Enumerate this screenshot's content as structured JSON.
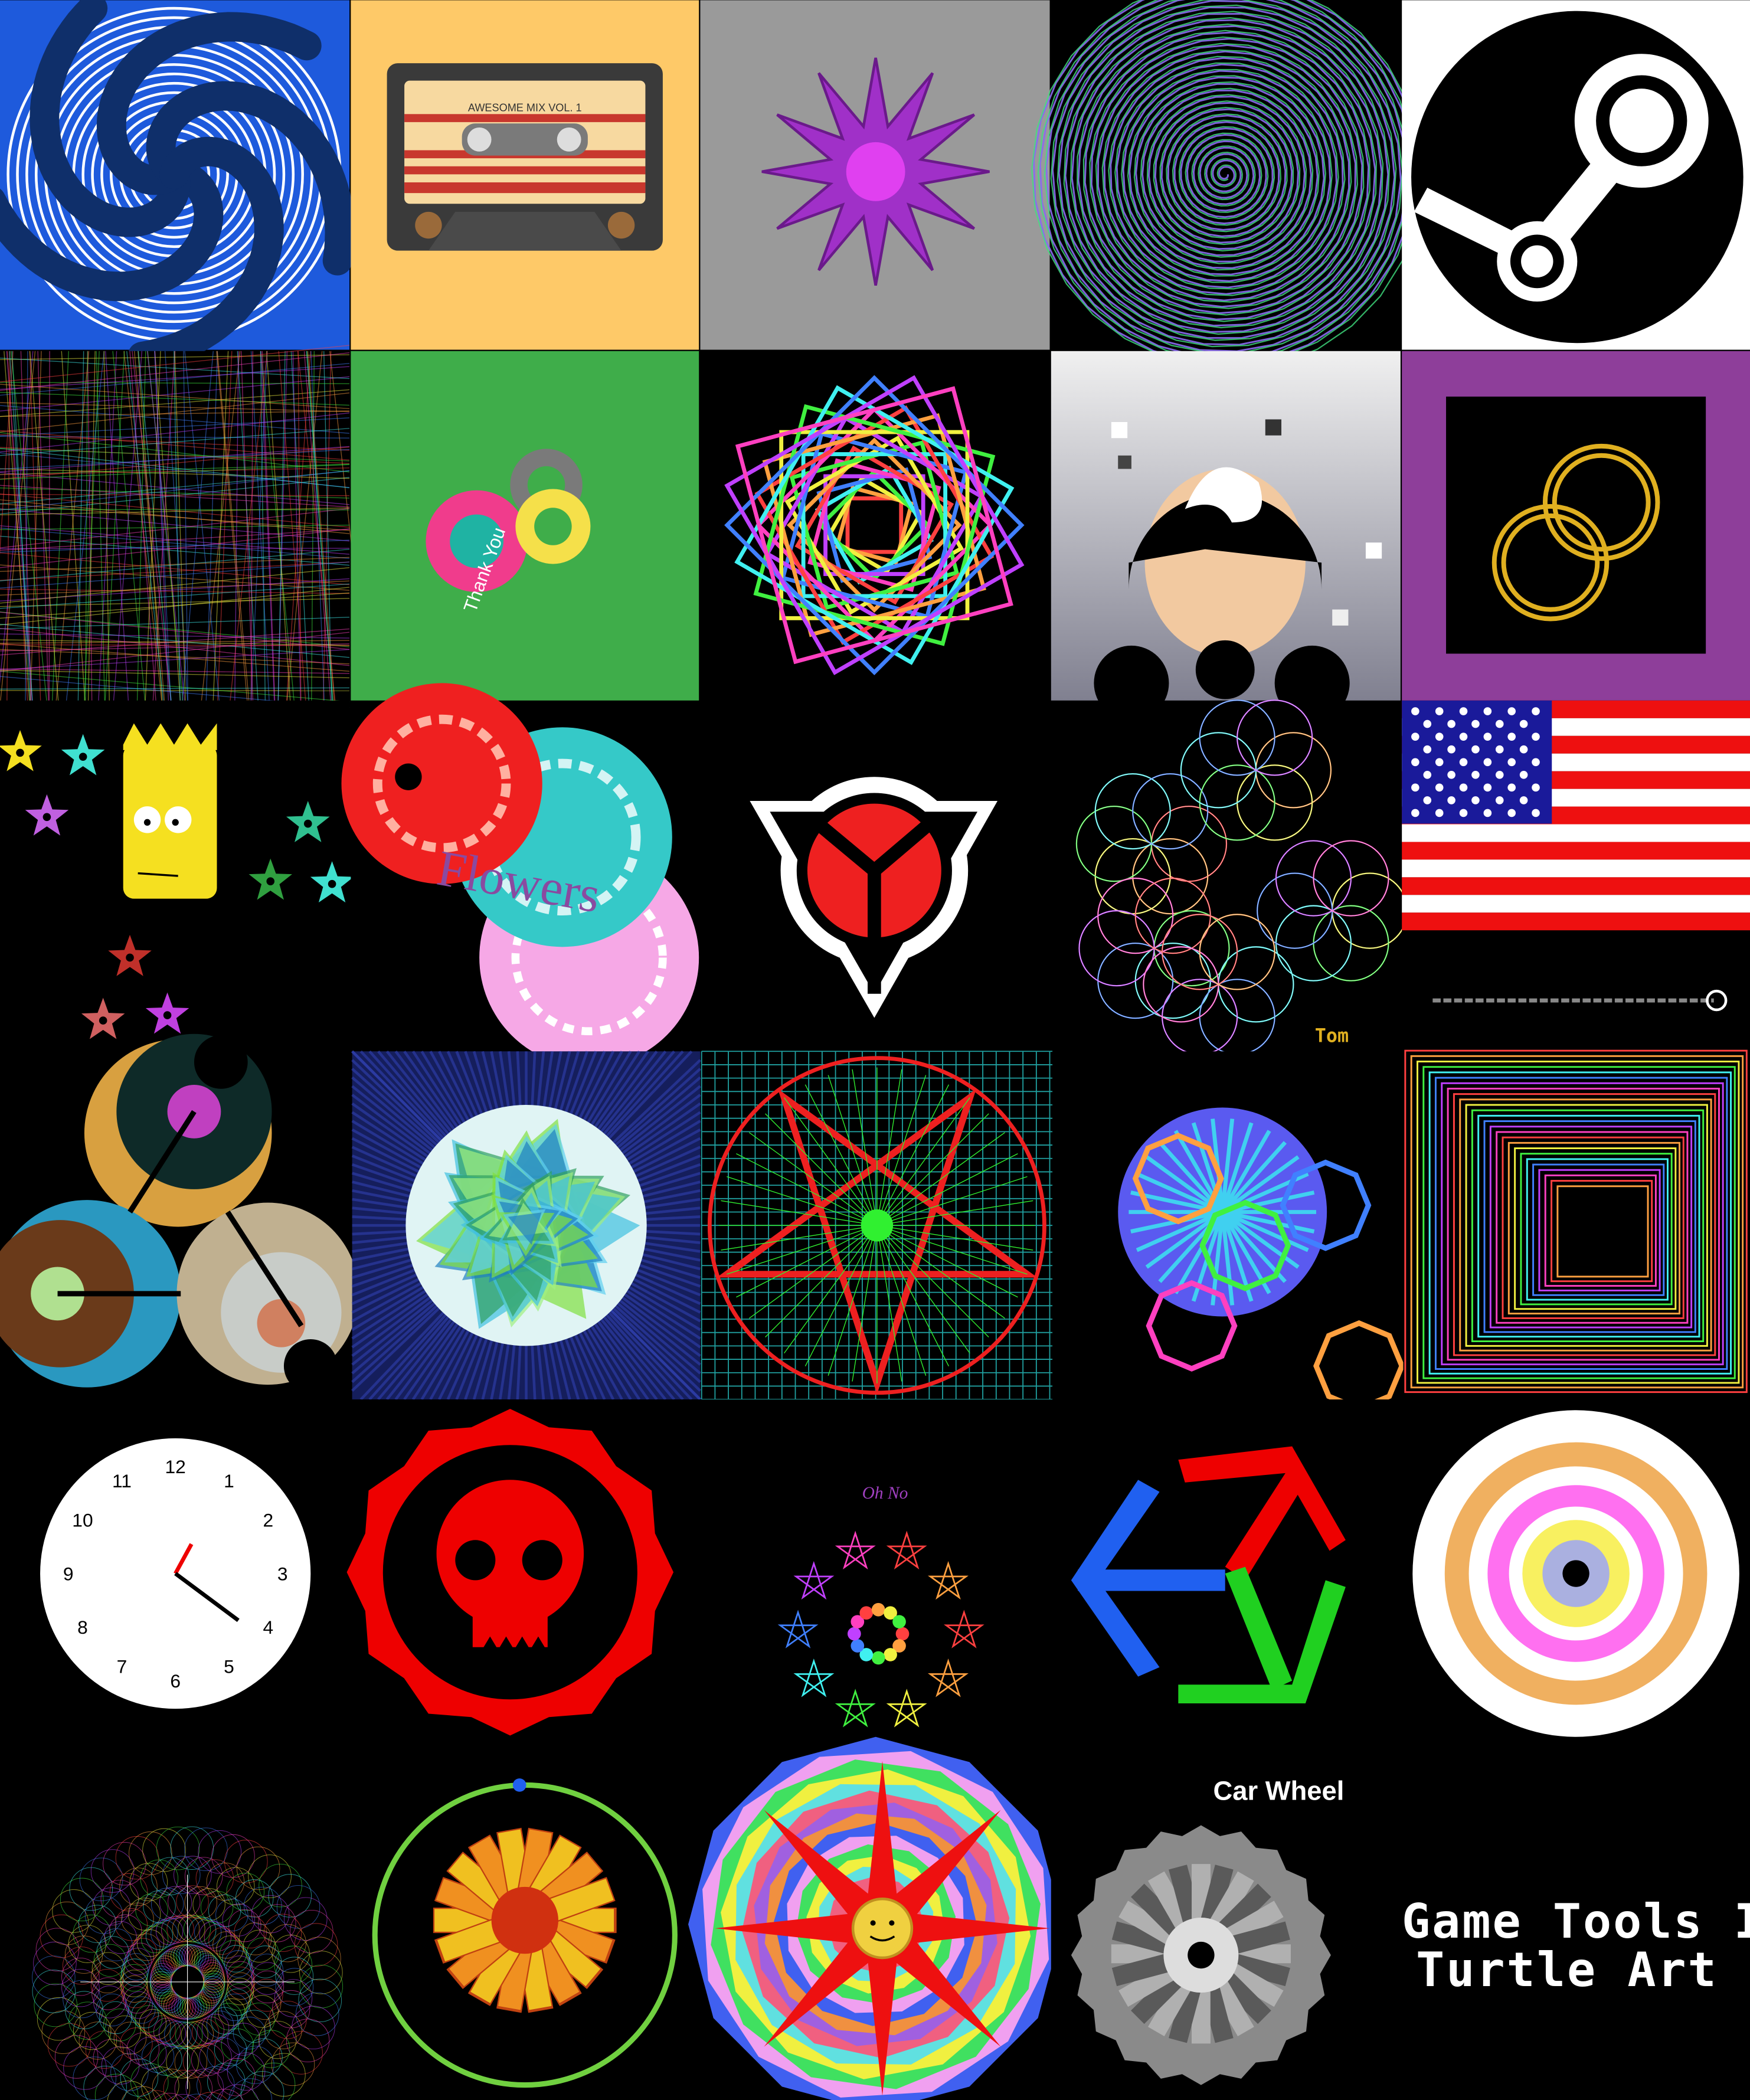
{
  "collage": {
    "title_line1": "Game Tools II",
    "title_line2": "Turtle Art",
    "tiles": [
      {
        "name": "spiral-swirl",
        "bg": "#1e5adc"
      },
      {
        "name": "cassette",
        "label": "AWESOME MIX VOL. 1",
        "bg": "#fec968"
      },
      {
        "name": "purple-star",
        "bg": "#9a9a9a"
      },
      {
        "name": "rainbow-spiral",
        "bg": "#000000"
      },
      {
        "name": "steam-logo",
        "bg": "#ffffff"
      },
      {
        "name": "string-noise",
        "bg": "#000000"
      },
      {
        "name": "thank-you",
        "label": "Thank You",
        "bg": "#3fad4a"
      },
      {
        "name": "square-mandala",
        "bg": "#000000"
      },
      {
        "name": "helmet-face",
        "bg": "#d8d8d8"
      },
      {
        "name": "gold-rings",
        "bg": "#8e3e9a"
      },
      {
        "name": "bart-stars",
        "bg": "#000000"
      },
      {
        "name": "flowers",
        "label": "Flowers",
        "bg": "#000000"
      },
      {
        "name": "helghast-logo",
        "bg": "#000000"
      },
      {
        "name": "flower-of-life",
        "label": "Tom",
        "bg": "#000000"
      },
      {
        "name": "us-flag",
        "bg": "#000000"
      },
      {
        "name": "circle-clocks",
        "bg": "#000000"
      },
      {
        "name": "green-globe",
        "bg": "#151e5c"
      },
      {
        "name": "pentagram",
        "bg": "#000000"
      },
      {
        "name": "blue-polygon",
        "bg": "#000000"
      },
      {
        "name": "square-tunnel",
        "bg": "#000000"
      },
      {
        "name": "clock",
        "bg": "#000000"
      },
      {
        "name": "skull-gear",
        "bg": "#000000"
      },
      {
        "name": "oh-no-stars",
        "label": "Oh No",
        "bg": "#000000"
      },
      {
        "name": "rgb-cube",
        "bg": "#000000"
      },
      {
        "name": "target",
        "bg": "#000000"
      },
      {
        "name": "dot-galaxy",
        "bg": "#000000"
      },
      {
        "name": "golden-wheel",
        "bg": "#000000"
      },
      {
        "name": "sun-face",
        "bg": "#000000"
      },
      {
        "name": "car-wheel",
        "label": "Car Wheel",
        "bg": "#000000"
      },
      {
        "name": "title",
        "bg": "#000000"
      }
    ]
  },
  "clock_numbers": [
    "12",
    "1",
    "2",
    "3",
    "4",
    "5",
    "6",
    "7",
    "8",
    "9",
    "10",
    "11"
  ]
}
